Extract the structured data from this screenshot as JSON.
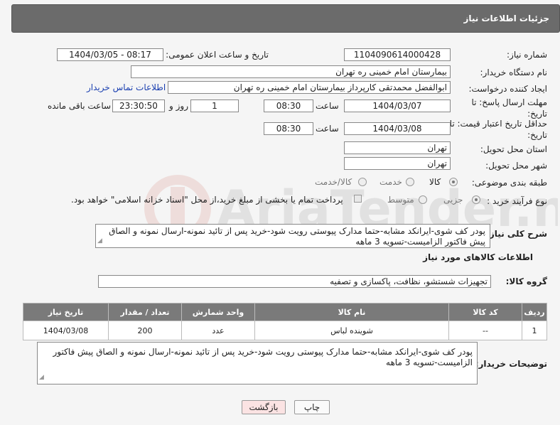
{
  "header": {
    "title": "جزئیات اطلاعات نیاز"
  },
  "form": {
    "need_number_label": "شماره نیاز:",
    "need_number": "1104090614000428",
    "announce_label": "تاریخ و ساعت اعلان عمومی:",
    "announce_value": "1404/03/05 - 08:17",
    "buyer_org_label": "نام دستگاه خریدار:",
    "buyer_org": "بیمارستان امام خمینی ره  تهران",
    "creator_label": "ایجاد کننده درخواست:",
    "creator": "ابوالفضل محمدتقی کارپرداز بیمارستان امام خمینی ره  تهران",
    "contact_link": "اطلاعات تماس خریدار",
    "reply_deadline_label": "مهلت ارسال پاسخ: تا تاریخ:",
    "reply_date": "1404/03/07",
    "time_label": "ساعت",
    "reply_time": "08:30",
    "days_value": "1",
    "days_label": "روز و",
    "remaining_time": "23:30:50",
    "remaining_label": "ساعت باقی مانده",
    "price_validity_label": "حداقل تاریخ اعتبار قیمت: تا تاریخ:",
    "price_date": "1404/03/08",
    "price_time": "08:30",
    "province_label": "استان محل تحویل:",
    "province": "تهران",
    "city_label": "شهر محل تحویل:",
    "city": "تهران",
    "category_label": "طبقه بندی موضوعی:",
    "category_options": [
      "کالا",
      "خدمت",
      "کالا/خدمت"
    ],
    "process_label": "نوع فرآیند خرید :",
    "process_options": [
      "جزیی",
      "متوسط"
    ],
    "payment_note": "پرداخت تمام یا بخشی از مبلغ خرید،از محل \"اسناد خزانه اسلامی\" خواهد بود.",
    "summary_label": "شرح کلی نیاز:",
    "summary": "پودر کف شوی-ایرانکد مشابه-حتما مدارک پیوستی رویت شود-خرید پس از تائید نمونه-ارسال نمونه و الصاق پیش فاکتور الزامیست-تسویه 3 ماهه"
  },
  "goods": {
    "section_title": "اطلاعات کالاهای مورد نیاز",
    "group_label": "گروه کالا:",
    "group_value": "تجهیزات شستشو، نظافت، پاکسازی و تصفیه",
    "columns": [
      "ردیف",
      "کد کالا",
      "نام کالا",
      "واحد شمارش",
      "تعداد / مقدار",
      "تاریخ نیاز"
    ],
    "rows": [
      [
        "1",
        "--",
        "شوینده لباس",
        "عدد",
        "200",
        "1404/03/08"
      ]
    ]
  },
  "buyer_notes": {
    "label": "توضیحات خریدار:",
    "text": "پودر کف شوی-ایرانکد مشابه-حتما مدارک پیوستی رویت شود-خرید پس از تائید نمونه-ارسال نمونه و الصاق پیش فاکتور الزامیست-تسویه 3 ماهه"
  },
  "buttons": {
    "print": "چاپ",
    "back": "بازگشت"
  },
  "watermark": {
    "text": "AriaTender.neT",
    "color": "#c0392b"
  }
}
